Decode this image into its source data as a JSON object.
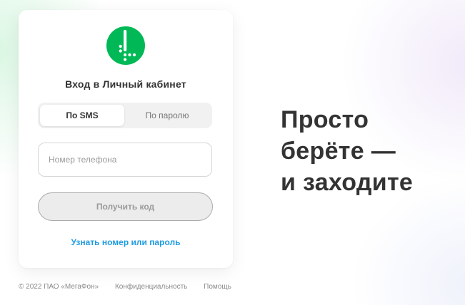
{
  "brand": {
    "logo_icon": "megafon-logo-icon",
    "accent_color": "#00b956"
  },
  "login_card": {
    "title": "Вход в Личный кабинет",
    "tabs": [
      {
        "label": "По SMS",
        "active": true
      },
      {
        "label": "По паролю",
        "active": false
      }
    ],
    "phone_input": {
      "placeholder": "Номер телефона",
      "value": ""
    },
    "submit_label": "Получить код",
    "recover_link": "Узнать номер или пароль",
    "link_color": "#1e9be0"
  },
  "footer": {
    "copyright": "© 2022 ПАО «МегаФон»",
    "privacy": "Конфиденциальность",
    "help": "Помощь"
  },
  "slogan": {
    "lines": [
      "Просто",
      "берёте —",
      "и заходите"
    ]
  }
}
